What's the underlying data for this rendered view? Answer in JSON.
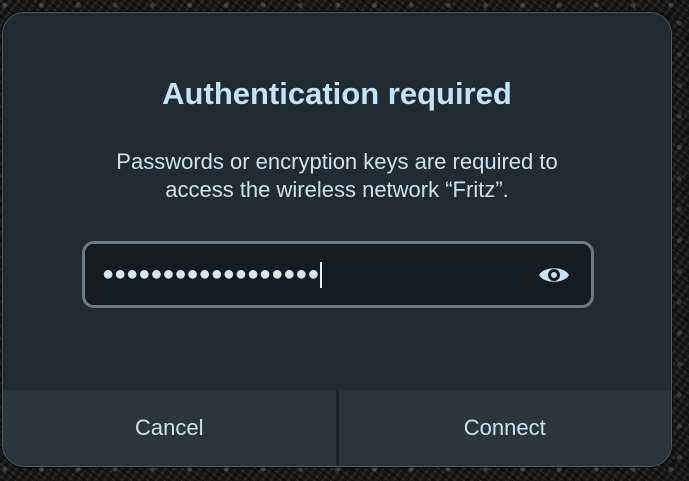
{
  "dialog": {
    "title": "Authentication required",
    "message": "Passwords or encryption keys are required to\naccess the wireless network “Fritz”.",
    "password": {
      "masked_value": "●●●●●●●●●●●●●●●●●●",
      "reveal_icon": "eye-icon"
    },
    "buttons": {
      "cancel_label": "Cancel",
      "connect_label": "Connect"
    }
  },
  "colors": {
    "dialog_bg": "#212b31",
    "title": "#c3e4f7",
    "text": "#c9e3f2",
    "field_bg": "#151b1f",
    "field_border": "#6b7a83",
    "footer_bg": "#2a363c"
  }
}
